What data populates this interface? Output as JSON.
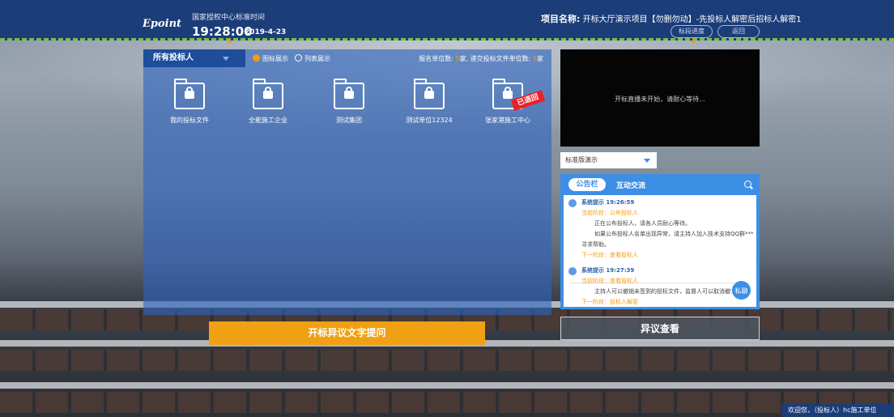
{
  "header": {
    "logo": "Epoint",
    "time_label": "国家授权中心标准时间",
    "clock": "19:28:00",
    "date": "2019-4-23",
    "project_label": "项目名称:",
    "project_name": "开标大厅演示项目【勿删勿动】-先投标人解密后招标人解密1",
    "progress_button": "标段进度",
    "back_button": "返回"
  },
  "left_panel": {
    "bidder_select": "所有投标人",
    "view_icon": "图标展示",
    "view_list": "列表展示",
    "count_label_1": "报名单位数: ",
    "count_value_1": "5",
    "count_label_2": "家, 递交投标文件单位数: ",
    "count_value_2": "5",
    "count_unit": "家",
    "folders": [
      {
        "name": "我的投标文件"
      },
      {
        "name": "全能施工企业"
      },
      {
        "name": "测试集团"
      },
      {
        "name": "测试单位12324"
      },
      {
        "name": "张家港施工中心",
        "badge": "已退回"
      }
    ]
  },
  "video": {
    "message": "开标直播未开始，请耐心等待..."
  },
  "mode_select": {
    "value": "标准版演示"
  },
  "notice": {
    "tab_notice": "公告栏",
    "tab_chat": "互动交流",
    "messages": [
      {
        "head": "系统提示 19:26:59",
        "stage": "当前阶段：公布投标人",
        "line1": "正在公布投标人，请各人员耐心等待。",
        "line2": "如果公布投标人名单出现异常，请主持人加入技术支持QQ群***",
        "line3": "寻求帮助。",
        "next": "下一阶段：查看投标人"
      },
      {
        "head": "系统提示 19:27:39",
        "stage": "当前阶段：查看投标人",
        "line1": "主持人可以撤销未签到的投标文件，监督人可以取消撤销",
        "next": "下一阶段：投标人解密"
      }
    ],
    "private_button": "私聊"
  },
  "bottom": {
    "objection_ask": "开标异议文字提问",
    "objection_view": "异议查看",
    "welcome": "欢迎您，（投标人）hc施工单位"
  },
  "colors": {
    "header_bg": "#1b3d78",
    "accent_orange": "#f0a013",
    "notice_blue": "#3d8fe6",
    "badge_red": "#e8222a"
  }
}
